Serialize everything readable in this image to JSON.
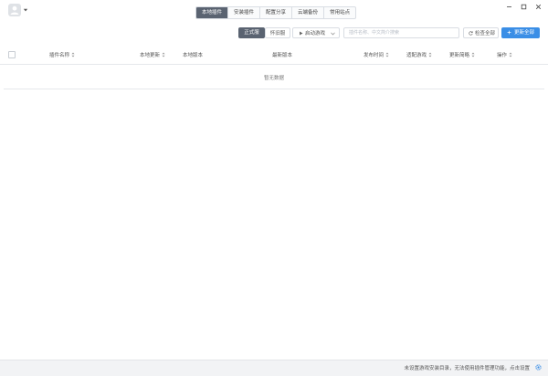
{
  "header": {
    "tabs": [
      {
        "label": "本地插件",
        "active": true
      },
      {
        "label": "安装插件",
        "active": false
      },
      {
        "label": "配置分享",
        "active": false
      },
      {
        "label": "云端备份",
        "active": false
      },
      {
        "label": "常用站点",
        "active": false
      }
    ],
    "window_controls": [
      "minimize-icon",
      "maximize-icon",
      "close-icon"
    ]
  },
  "toolbar": {
    "official_label": "正式服",
    "classic_label": "怀旧服",
    "dropdown_label": "启动游戏",
    "search_placeholder": "插件名称、中文简介搜索",
    "check_all_label": "检查全部",
    "update_all_label": "更新全部"
  },
  "table": {
    "columns": [
      "插件名称",
      "本地更新",
      "本地版本",
      "最新版本",
      "发布时间",
      "适配游戏",
      "更新简略",
      "操作"
    ],
    "empty_text": "暂无数据"
  },
  "status": {
    "message": "未设置游戏安装目录，无法使用插件管理功能，点击设置"
  },
  "colors": {
    "accent": "#3a8ee6",
    "active_tab": "#5a6371",
    "status_icon": "#3a8ee6"
  }
}
